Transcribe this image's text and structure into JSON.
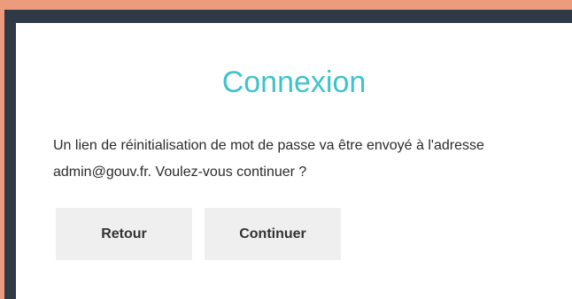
{
  "dialog": {
    "title": "Connexion",
    "message": "Un lien de réinitialisation de mot de passe va être envoyé à l'adresse admin@gouv.fr. Voulez-vous continuer ?",
    "back_label": "Retour",
    "continue_label": "Continuer"
  },
  "colors": {
    "backdrop": "#ec9b7d",
    "frame": "#2f3a46",
    "title": "#3ec3cc",
    "button_bg": "#efefef"
  }
}
